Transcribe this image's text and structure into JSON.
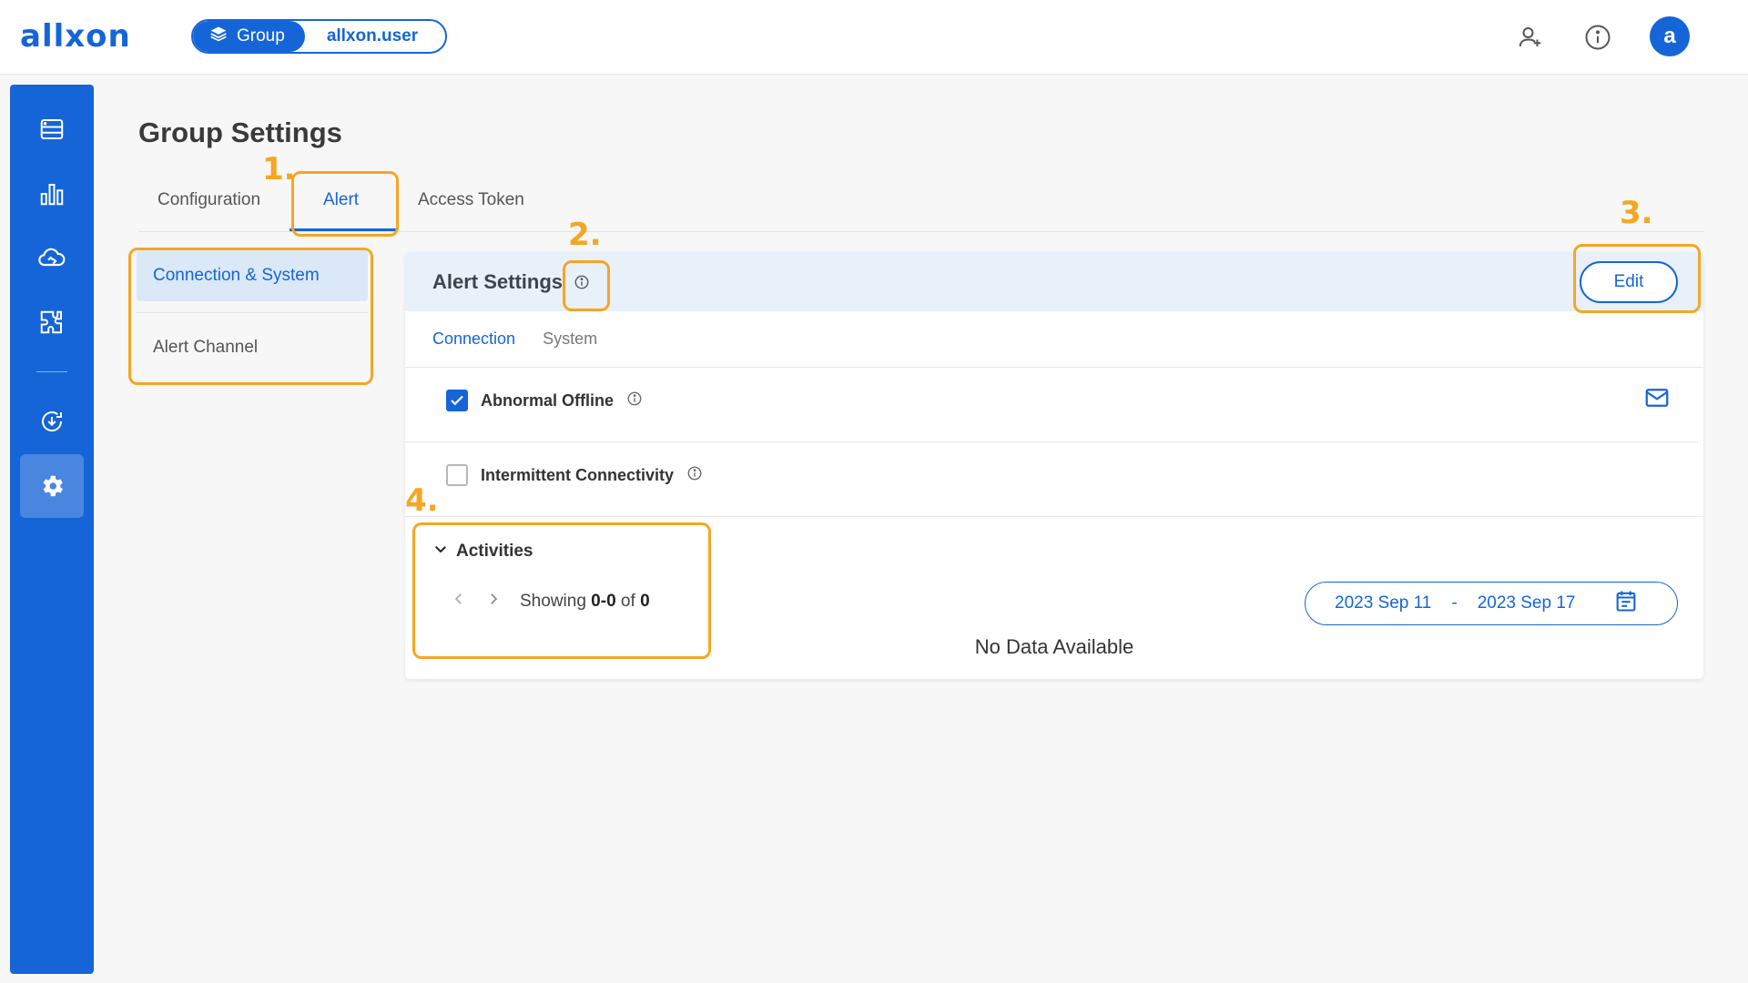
{
  "topbar": {
    "logo": "allxon",
    "group_label": "Group",
    "username": "allxon.user",
    "avatar_letter": "a"
  },
  "page": {
    "title": "Group Settings"
  },
  "tabs": [
    {
      "label": "Configuration"
    },
    {
      "label": "Alert"
    },
    {
      "label": "Access Token"
    }
  ],
  "side_menu": [
    {
      "label": "Connection & System"
    },
    {
      "label": "Alert Channel"
    }
  ],
  "card": {
    "title": "Alert Settings",
    "edit_label": "Edit",
    "subtabs": [
      {
        "label": "Connection"
      },
      {
        "label": "System"
      }
    ],
    "rows": [
      {
        "label": "Abnormal Offline",
        "checked": true
      },
      {
        "label": "Intermittent Connectivity",
        "checked": false
      }
    ],
    "activities_label": "Activities",
    "pager": {
      "prefix": "Showing",
      "range": "0-0",
      "of": "of",
      "total": "0"
    },
    "date_start": "2023 Sep 11",
    "date_sep": "-",
    "date_end": "2023 Sep 17",
    "no_data": "No Data Available"
  },
  "annotations": [
    "1.",
    "2.",
    "3.",
    "4."
  ],
  "colors": {
    "primary": "#1565d8",
    "highlight": "#f5a623",
    "header_bg": "#e8f0fa"
  }
}
